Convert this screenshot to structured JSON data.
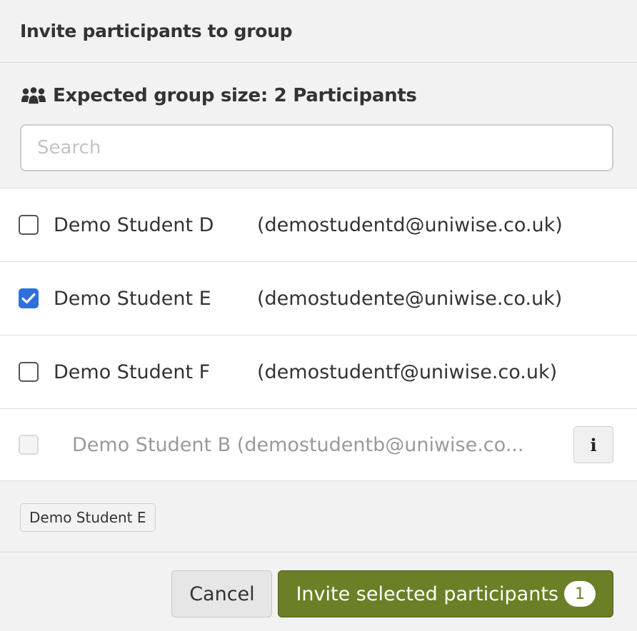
{
  "dialog": {
    "title": "Invite participants to group"
  },
  "group_info": {
    "icon": "group-icon",
    "expected_size_text": "Expected group size: 2 Participants"
  },
  "search": {
    "placeholder": "Search",
    "value": ""
  },
  "participants": [
    {
      "name": "Demo Student D",
      "email": "(demostudentd@uniwise.co.uk)",
      "checked": false,
      "disabled": false
    },
    {
      "name": "Demo Student E",
      "email": "(demostudente@uniwise.co.uk)",
      "checked": true,
      "disabled": false
    },
    {
      "name": "Demo Student F",
      "email": "(demostudentf@uniwise.co.uk)",
      "checked": false,
      "disabled": false
    },
    {
      "name_email": "Demo Student B (demostudentb@uniwise.co...",
      "checked": false,
      "disabled": true,
      "info_label": "i"
    }
  ],
  "selected_chips": [
    "Demo Student E"
  ],
  "footer": {
    "cancel_label": "Cancel",
    "invite_label": "Invite selected participants",
    "selected_count": "1"
  },
  "colors": {
    "accent_green": "#6b7f26",
    "checkbox_blue": "#2f6fdb"
  }
}
